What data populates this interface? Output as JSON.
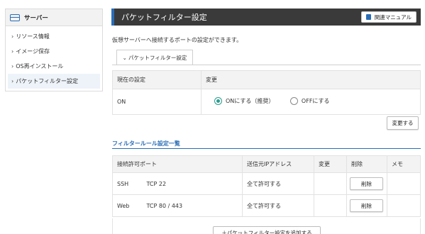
{
  "sidebar": {
    "header": "サーバー",
    "items": [
      {
        "label": "リソース情報"
      },
      {
        "label": "イメージ保存"
      },
      {
        "label": "OS再インストール"
      },
      {
        "label": "パケットフィルター設定"
      }
    ]
  },
  "title": "パケットフィルター設定",
  "manual_button": "関連マニュアル",
  "description": "仮想サーバーへ接続するポートの設定ができます。",
  "tab_label": "パケットフィルター設定",
  "current_table": {
    "header_current": "現在の設定",
    "header_change": "変更",
    "current_value": "ON",
    "option_on": "ONにする（推奨）",
    "option_off": "OFFにする",
    "selected": "on"
  },
  "change_button": "変更する",
  "rules_section_title": "フィルタールール設定一覧",
  "rules_table": {
    "headers": [
      "接続許可ポート",
      "送信元IPアドレス",
      "変更",
      "削除",
      "メモ"
    ],
    "rows": [
      {
        "name": "SSH",
        "port": "TCP 22",
        "source": "全て許可する",
        "delete": "削除"
      },
      {
        "name": "Web",
        "port": "TCP 80 / 443",
        "source": "全て許可する",
        "delete": "削除"
      }
    ]
  },
  "add_button": "＋パケットフィルター設定を追加する",
  "colors": {
    "accent": "#2a6db5",
    "title_bg": "#3a3a3a",
    "radio": "#2a9d8f"
  }
}
